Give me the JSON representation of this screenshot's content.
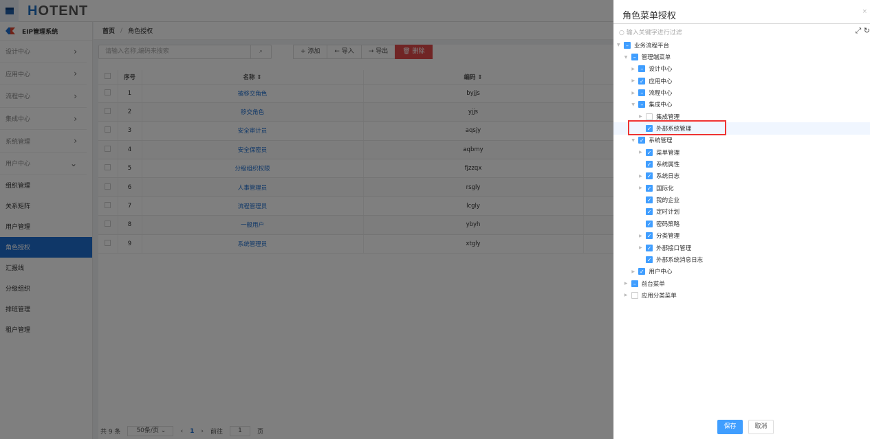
{
  "header": {
    "logo_h": "H",
    "logo_rest": "OTENT"
  },
  "sidebar": {
    "system": "EIP管理系统",
    "groups": [
      {
        "label": "设计中心",
        "chev": "›"
      },
      {
        "label": "应用中心",
        "chev": "›"
      },
      {
        "label": "流程中心",
        "chev": "›"
      },
      {
        "label": "集成中心",
        "chev": "›"
      },
      {
        "label": "系统管理",
        "chev": "›"
      },
      {
        "label": "用户中心",
        "chev": "⌄"
      }
    ],
    "items": [
      "组织管理",
      "关系矩阵",
      "用户管理",
      "角色授权",
      "汇报线",
      "分级组织",
      "排班管理",
      "租户管理"
    ],
    "active_index": 3
  },
  "breadcrumb": {
    "home": "首页",
    "sep": "/",
    "current": "角色授权"
  },
  "toolbar": {
    "search_placeholder": "请输入名称,编码来搜索",
    "search_icon": "⌕",
    "add": "+ 添加",
    "import": "← 导入",
    "export": "→ 导出",
    "delete": "🗑 删除"
  },
  "table": {
    "headers": [
      "序号",
      "名称 ⇕",
      "编码 ⇕"
    ],
    "rows": [
      [
        "1",
        "被移交角色",
        "byjjs"
      ],
      [
        "2",
        "移交角色",
        "yjjs"
      ],
      [
        "3",
        "安全审计员",
        "aqsjy"
      ],
      [
        "4",
        "安全保密员",
        "aqbmy"
      ],
      [
        "5",
        "分级组织权限",
        "fjzzqx"
      ],
      [
        "6",
        "人事管理员",
        "rsgly"
      ],
      [
        "7",
        "流程管理员",
        "lcgly"
      ],
      [
        "8",
        "一般用户",
        "ybyh"
      ],
      [
        "9",
        "系统管理员",
        "xtgly"
      ]
    ]
  },
  "pager": {
    "total": "共 9 条",
    "page_size": "50条/页 ⌄",
    "prev": "‹",
    "current": "1",
    "next": "›",
    "goto": "前往",
    "goto_value": "1",
    "page_suffix": "页"
  },
  "drawer": {
    "title": "角色菜单授权",
    "close": "×",
    "filter_placeholder": "○ 输入关键字进行过滤",
    "expand_icon": "⤢",
    "refresh_icon": "↻",
    "save": "保存",
    "cancel": "取消",
    "tree": [
      {
        "label": "业务流程平台",
        "level": 0,
        "state": "half",
        "arrow": "down"
      },
      {
        "label": "管理端菜单",
        "level": 1,
        "state": "half",
        "arrow": "down"
      },
      {
        "label": "设计中心",
        "level": 2,
        "state": "half",
        "arrow": "right"
      },
      {
        "label": "应用中心",
        "level": 2,
        "state": "on",
        "arrow": "right"
      },
      {
        "label": "流程中心",
        "level": 2,
        "state": "half",
        "arrow": "right"
      },
      {
        "label": "集成中心",
        "level": 2,
        "state": "half",
        "arrow": "down"
      },
      {
        "label": "集成管理",
        "level": 3,
        "state": "off",
        "arrow": "right"
      },
      {
        "label": "外部系统管理",
        "level": 3,
        "state": "on",
        "arrow": "",
        "highlight": true
      },
      {
        "label": "系统管理",
        "level": 2,
        "state": "on",
        "arrow": "down"
      },
      {
        "label": "菜单管理",
        "level": 3,
        "state": "on",
        "arrow": "right"
      },
      {
        "label": "系统属性",
        "level": 3,
        "state": "on",
        "arrow": ""
      },
      {
        "label": "系统日志",
        "level": 3,
        "state": "on",
        "arrow": "right"
      },
      {
        "label": "国际化",
        "level": 3,
        "state": "on",
        "arrow": "right"
      },
      {
        "label": "我的企业",
        "level": 3,
        "state": "on",
        "arrow": ""
      },
      {
        "label": "定时计划",
        "level": 3,
        "state": "on",
        "arrow": ""
      },
      {
        "label": "密码策略",
        "level": 3,
        "state": "on",
        "arrow": ""
      },
      {
        "label": "分类管理",
        "level": 3,
        "state": "on",
        "arrow": "right"
      },
      {
        "label": "外部接口管理",
        "level": 3,
        "state": "on",
        "arrow": "right"
      },
      {
        "label": "外部系统消息日志",
        "level": 3,
        "state": "on",
        "arrow": ""
      },
      {
        "label": "用户中心",
        "level": 2,
        "state": "on",
        "arrow": "right"
      },
      {
        "label": "前台菜单",
        "level": 1,
        "state": "half",
        "arrow": "right"
      },
      {
        "label": "应用分类菜单",
        "level": 1,
        "state": "off",
        "arrow": "right"
      }
    ]
  }
}
